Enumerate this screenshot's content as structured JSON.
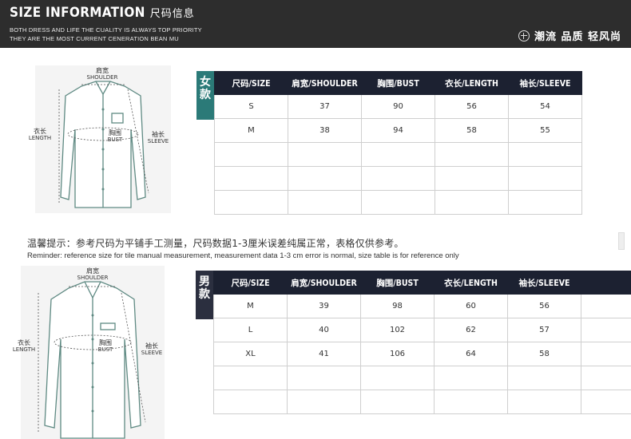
{
  "header": {
    "title": "SIZE INFORMATION",
    "title_cn": "尺码信息",
    "subtitle_line1": "BOTH DRESS AND LIFE THE CUALITY IS ALWAYS TOP PRIORITY",
    "subtitle_line2": "THEY ARE THE MOST CURRENT  CENERATION BEAN MU",
    "tagline": "潮流 品质 轻风尚"
  },
  "diagram_labels": {
    "shoulder_cn": "肩宽",
    "shoulder_en": "SHOULDER",
    "length_cn": "衣长",
    "length_en": "LENGTH",
    "bust_cn": "胸围",
    "bust_en": "BUST",
    "sleeve_cn": "袖长",
    "sleeve_en": "SLEEVE"
  },
  "women": {
    "tab_label": "女款",
    "tab_color": "#2b7a78",
    "headers": [
      "尺码/SIZE",
      "肩宽/SHOULDER",
      "胸围/BUST",
      "衣长/LENGTH",
      "袖长/SLEEVE"
    ],
    "rows": [
      [
        "S",
        "37",
        "90",
        "56",
        "54"
      ],
      [
        "M",
        "38",
        "94",
        "58",
        "55"
      ],
      [
        "",
        "",
        "",
        "",
        ""
      ],
      [
        "",
        "",
        "",
        "",
        ""
      ],
      [
        "",
        "",
        "",
        "",
        ""
      ]
    ]
  },
  "men": {
    "tab_label": "男款",
    "tab_color": "#2b2f3f",
    "headers": [
      "尺码/SIZE",
      "肩宽/SHOULDER",
      "胸围/BUST",
      "衣长/LENGTH",
      "袖长/SLEEVE"
    ],
    "rows": [
      [
        "M",
        "39",
        "98",
        "60",
        "56"
      ],
      [
        "L",
        "40",
        "102",
        "62",
        "57"
      ],
      [
        "XL",
        "41",
        "106",
        "64",
        "58"
      ],
      [
        "",
        "",
        "",
        "",
        ""
      ],
      [
        "",
        "",
        "",
        "",
        ""
      ]
    ]
  },
  "notice": {
    "cn": "温馨提示：参考尺码为平铺手工测量，尺码数据1-3厘米误差纯属正常，表格仅供参考。",
    "en": "Reminder: reference size for tile manual measurement, measurement data 1-3 cm error is normal, size table is for reference only"
  }
}
